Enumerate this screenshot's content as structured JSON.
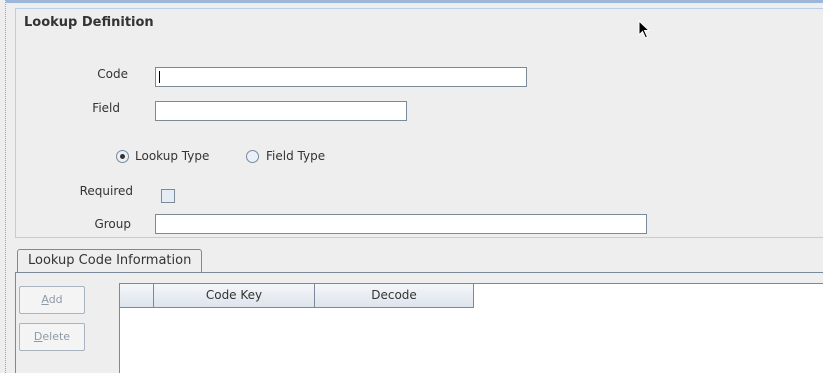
{
  "panel": {
    "title": "Lookup Definition"
  },
  "form": {
    "code_label": "Code",
    "code_value": "",
    "field_label": "Field",
    "field_value": "",
    "radio_lookup_type": "Lookup Type",
    "radio_field_type": "Field Type",
    "selected_radio": "Lookup Type",
    "required_label": "Required",
    "required_checked": false,
    "group_label": "Group",
    "group_value": ""
  },
  "tabs": [
    {
      "label": "Lookup Code Information",
      "active": true
    }
  ],
  "actions": {
    "add": "Add",
    "delete": "Delete"
  },
  "table": {
    "columns": [
      "",
      "Code Key",
      "Decode"
    ],
    "rows": []
  }
}
